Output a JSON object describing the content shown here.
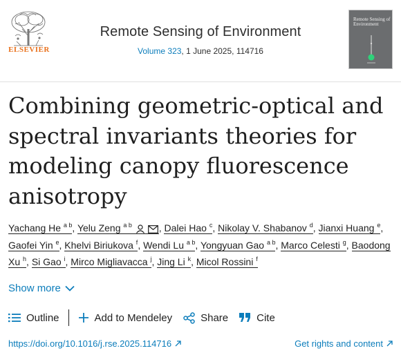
{
  "header": {
    "publisher": "ELSEVIER",
    "journal_title": "Remote Sensing of Environment",
    "volume": "Volume 323",
    "issue_details": ", 1 June 2025, 114716",
    "cover_title": "Remote Sensing of Environment"
  },
  "article": {
    "title_lines": [
      "Combining geometric-optical and",
      "spectral invariants theories for",
      "modeling canopy fluorescence",
      "anisotropy"
    ]
  },
  "authors": [
    {
      "name": "Yachang He",
      "aff": "a b"
    },
    {
      "name": "Yelu Zeng",
      "aff": "a b"
    },
    {
      "name": "Dalei Hao",
      "aff": "c"
    },
    {
      "name": "Nikolay V. Shabanov",
      "aff": "d"
    },
    {
      "name": "Jianxi Huang",
      "aff": "e"
    },
    {
      "name": "Gaofei Yin",
      "aff": "e"
    },
    {
      "name": "Khelvi Biriukova",
      "aff": "f"
    },
    {
      "name": "Wendi Lu",
      "aff": "a b"
    },
    {
      "name": "Yongyuan Gao",
      "aff": "a b"
    },
    {
      "name": "Marco Celesti",
      "aff": "g"
    },
    {
      "name": "Baodong Xu",
      "aff": "h"
    },
    {
      "name": "Si Gao",
      "aff": "i"
    },
    {
      "name": "Mirco Migliavacca",
      "aff": "j"
    },
    {
      "name": "Jing Li",
      "aff": "k"
    },
    {
      "name": "Micol Rossini",
      "aff": "f"
    }
  ],
  "show_more_label": "Show more",
  "toolbar": {
    "outline": "Outline",
    "mendeley": "Add to Mendeley",
    "share": "Share",
    "cite": "Cite"
  },
  "links": {
    "doi": "https://doi.org/10.1016/j.rse.2025.114716",
    "rights": "Get rights and content"
  },
  "colors": {
    "link": "#0c7dbb",
    "publisher_orange": "#e9711c",
    "text": "#1f1f1f"
  }
}
